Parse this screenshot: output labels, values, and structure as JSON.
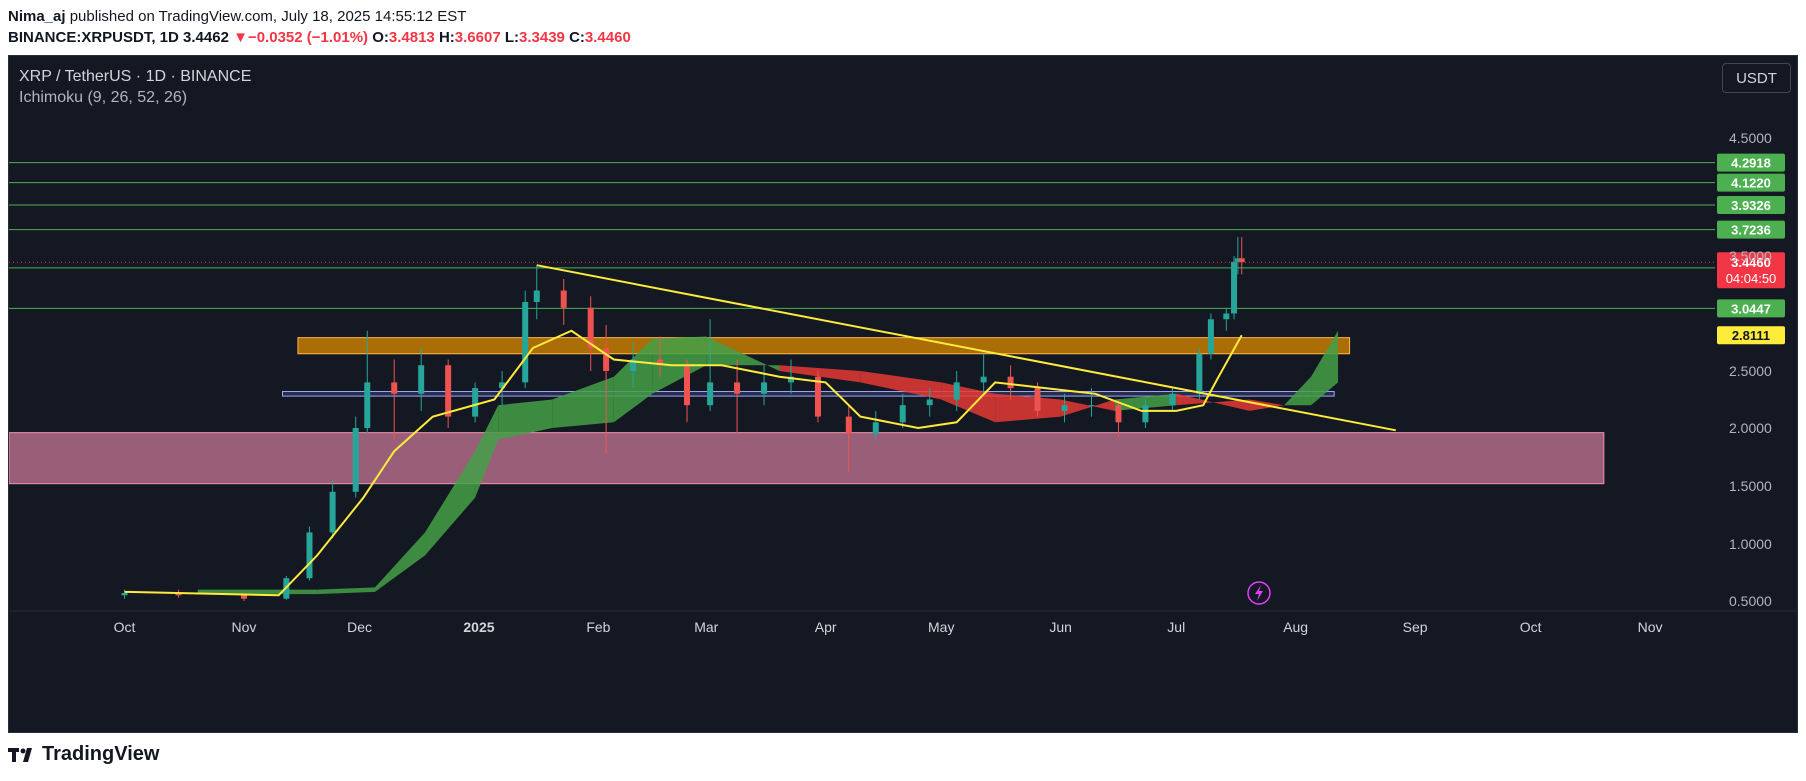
{
  "header": {
    "author": "Nima_aj",
    "published_text": "published on TradingView.com, July 18, 2025 14:55:12 EST",
    "symbol_interval": "BINANCE:XRPUSDT, 1D",
    "last": "3.4462",
    "change_arrow": "▼",
    "change": "−0.0352 (−1.01%)",
    "open_label": "O:",
    "open": "3.4813",
    "high_label": "H:",
    "high": "3.6607",
    "low_label": "L:",
    "low": "3.3439",
    "close_label": "C:",
    "close": "3.4460"
  },
  "legend": {
    "symbol_title": "XRP / TetherUS · 1D · BINANCE",
    "indicator": "Ichimoku (9, 26, 52, 26)"
  },
  "toolbar": {
    "currency": "USDT"
  },
  "footer": {
    "logo_text": "TradingView",
    "logo_icon": "tradingview-logo-icon"
  },
  "colors": {
    "background": "#141823",
    "up": "#26a69a",
    "down": "#ef5350",
    "kijun": "#ffeb3b",
    "cloud_bull": "#43a047",
    "cloud_bear": "#e53935",
    "level_line": "#4caf50",
    "resistance_zone": "#c67c00",
    "support_zone": "#f48fb1",
    "mid_band": "#9fa8ff"
  },
  "chart_data": {
    "type": "candlestick",
    "symbol": "XRPUSDT",
    "interval": "1D",
    "ylim": [
      0.3,
      5.1
    ],
    "y_ticks": [
      "4.5000",
      "3.5000",
      "2.5000",
      "2.0000",
      "1.5000",
      "1.0000",
      "0.5000"
    ],
    "x_ticks": [
      "Oct",
      "Nov",
      "Dec",
      "2025",
      "Feb",
      "Mar",
      "Apr",
      "May",
      "Jun",
      "Jul",
      "Aug",
      "Sep",
      "Oct",
      "Nov"
    ],
    "x_tick_dates": [
      "2024-10-01",
      "2024-11-01",
      "2024-12-01",
      "2025-01-01",
      "2025-02-01",
      "2025-03-01",
      "2025-04-01",
      "2025-05-01",
      "2025-06-01",
      "2025-07-01",
      "2025-08-01",
      "2025-09-01",
      "2025-10-01",
      "2025-11-01"
    ],
    "horizontal_levels": [
      {
        "label": "4.2918",
        "value": 4.2918
      },
      {
        "label": "4.1220",
        "value": 4.122
      },
      {
        "label": "3.9326",
        "value": 3.9326
      },
      {
        "label": "3.7236",
        "value": 3.7236
      },
      {
        "label": "3.3970",
        "value": 3.397
      },
      {
        "label": "3.0447",
        "value": 3.0447
      }
    ],
    "last_price": {
      "label": "3.4460",
      "value": 3.446,
      "countdown": "04:04:50"
    },
    "kijun_last": {
      "label": "2.8111",
      "value": 2.8111
    },
    "zones": [
      {
        "name": "resistance-zone",
        "low": 2.65,
        "high": 2.79,
        "from": "2024-11-15",
        "to": "2025-08-15"
      },
      {
        "name": "mid-band",
        "low": 2.28,
        "high": 2.32,
        "from": "2024-11-11",
        "to": "2025-08-11"
      },
      {
        "name": "support-zone",
        "low": 1.52,
        "high": 1.96,
        "from": "2024-09-01",
        "to": "2025-10-20"
      }
    ],
    "trendline": {
      "from": {
        "date": "2025-01-16",
        "value": 3.42
      },
      "to": {
        "date": "2025-08-27",
        "value": 1.98
      }
    },
    "ohlc": [
      [
        "2024-10-01",
        0.55,
        0.6,
        0.52,
        0.57
      ],
      [
        "2024-10-15",
        0.57,
        0.6,
        0.53,
        0.55
      ],
      [
        "2024-11-01",
        0.55,
        0.56,
        0.5,
        0.52
      ],
      [
        "2024-11-12",
        0.52,
        0.72,
        0.51,
        0.7
      ],
      [
        "2024-11-18",
        0.7,
        1.15,
        0.68,
        1.1
      ],
      [
        "2024-11-24",
        1.1,
        1.55,
        1.05,
        1.45
      ],
      [
        "2024-11-30",
        1.45,
        2.1,
        1.4,
        2.0
      ],
      [
        "2024-12-03",
        2.0,
        2.85,
        1.95,
        2.4
      ],
      [
        "2024-12-10",
        2.4,
        2.6,
        1.9,
        2.3
      ],
      [
        "2024-12-17",
        2.3,
        2.7,
        2.15,
        2.55
      ],
      [
        "2024-12-24",
        2.55,
        2.6,
        2.0,
        2.1
      ],
      [
        "2024-12-31",
        2.1,
        2.4,
        2.05,
        2.35
      ],
      [
        "2025-01-07",
        2.35,
        2.5,
        2.2,
        2.4
      ],
      [
        "2025-01-13",
        2.4,
        3.2,
        2.35,
        3.1
      ],
      [
        "2025-01-16",
        3.1,
        3.42,
        2.95,
        3.2
      ],
      [
        "2025-01-23",
        3.2,
        3.3,
        2.9,
        3.05
      ],
      [
        "2025-01-30",
        3.05,
        3.15,
        2.5,
        2.7
      ],
      [
        "2025-02-03",
        2.7,
        2.9,
        1.78,
        2.5
      ],
      [
        "2025-02-10",
        2.5,
        2.75,
        2.35,
        2.6
      ],
      [
        "2025-02-17",
        2.6,
        2.8,
        2.45,
        2.55
      ],
      [
        "2025-02-24",
        2.55,
        2.6,
        2.05,
        2.2
      ],
      [
        "2025-03-02",
        2.2,
        2.95,
        2.15,
        2.4
      ],
      [
        "2025-03-09",
        2.4,
        2.6,
        1.95,
        2.3
      ],
      [
        "2025-03-16",
        2.3,
        2.55,
        2.2,
        2.4
      ],
      [
        "2025-03-23",
        2.4,
        2.6,
        2.3,
        2.45
      ],
      [
        "2025-03-30",
        2.45,
        2.5,
        2.05,
        2.1
      ],
      [
        "2025-04-07",
        2.1,
        2.2,
        1.62,
        1.95
      ],
      [
        "2025-04-14",
        1.95,
        2.15,
        1.9,
        2.05
      ],
      [
        "2025-04-21",
        2.05,
        2.3,
        2.0,
        2.2
      ],
      [
        "2025-04-28",
        2.2,
        2.35,
        2.1,
        2.25
      ],
      [
        "2025-05-05",
        2.25,
        2.5,
        2.15,
        2.4
      ],
      [
        "2025-05-12",
        2.4,
        2.65,
        2.3,
        2.45
      ],
      [
        "2025-05-19",
        2.45,
        2.55,
        2.25,
        2.35
      ],
      [
        "2025-05-26",
        2.35,
        2.4,
        2.1,
        2.15
      ],
      [
        "2025-06-02",
        2.15,
        2.3,
        2.05,
        2.2
      ],
      [
        "2025-06-09",
        2.2,
        2.35,
        2.1,
        2.2
      ],
      [
        "2025-06-16",
        2.2,
        2.25,
        1.92,
        2.05
      ],
      [
        "2025-06-23",
        2.05,
        2.25,
        2.0,
        2.2
      ],
      [
        "2025-06-30",
        2.2,
        2.35,
        2.15,
        2.3
      ],
      [
        "2025-07-07",
        2.3,
        2.7,
        2.25,
        2.65
      ],
      [
        "2025-07-10",
        2.65,
        3.0,
        2.6,
        2.95
      ],
      [
        "2025-07-14",
        2.95,
        3.05,
        2.85,
        3.0
      ],
      [
        "2025-07-16",
        3.0,
        3.5,
        2.95,
        3.45
      ],
      [
        "2025-07-17",
        3.45,
        3.66,
        3.34,
        3.48
      ],
      [
        "2025-07-18",
        3.48,
        3.66,
        3.34,
        3.446
      ]
    ],
    "kijun_sen": [
      [
        "2024-10-01",
        0.58
      ],
      [
        "2024-11-10",
        0.55
      ],
      [
        "2024-11-20",
        0.9
      ],
      [
        "2024-12-02",
        1.4
      ],
      [
        "2024-12-10",
        1.8
      ],
      [
        "2024-12-20",
        2.1
      ],
      [
        "2025-01-05",
        2.25
      ],
      [
        "2025-01-15",
        2.7
      ],
      [
        "2025-01-25",
        2.85
      ],
      [
        "2025-02-05",
        2.6
      ],
      [
        "2025-02-20",
        2.55
      ],
      [
        "2025-03-05",
        2.55
      ],
      [
        "2025-03-20",
        2.45
      ],
      [
        "2025-04-01",
        2.4
      ],
      [
        "2025-04-10",
        2.1
      ],
      [
        "2025-04-25",
        2.0
      ],
      [
        "2025-05-05",
        2.05
      ],
      [
        "2025-05-15",
        2.4
      ],
      [
        "2025-05-28",
        2.35
      ],
      [
        "2025-06-10",
        2.3
      ],
      [
        "2025-06-22",
        2.15
      ],
      [
        "2025-07-01",
        2.15
      ],
      [
        "2025-07-08",
        2.2
      ],
      [
        "2025-07-12",
        2.45
      ],
      [
        "2025-07-18",
        2.8111
      ]
    ],
    "cloud": [
      [
        "2024-10-20",
        0.56,
        0.6
      ],
      [
        "2024-11-20",
        0.56,
        0.6
      ],
      [
        "2024-12-05",
        0.58,
        0.62
      ],
      [
        "2024-12-18",
        0.9,
        1.1
      ],
      [
        "2024-12-31",
        1.4,
        1.8
      ],
      [
        "2025-01-06",
        1.9,
        2.2
      ],
      [
        "2025-01-20",
        2.0,
        2.25
      ],
      [
        "2025-02-05",
        2.05,
        2.45
      ],
      [
        "2025-02-15",
        2.3,
        2.78
      ],
      [
        "2025-03-01",
        2.55,
        2.8
      ],
      [
        "2025-03-20",
        2.55,
        2.5
      ],
      [
        "2025-04-10",
        2.5,
        2.4
      ],
      [
        "2025-05-01",
        2.4,
        2.25
      ],
      [
        "2025-05-15",
        2.3,
        2.05
      ],
      [
        "2025-06-01",
        2.25,
        2.1
      ],
      [
        "2025-06-15",
        2.15,
        2.25
      ],
      [
        "2025-07-01",
        2.2,
        2.3
      ],
      [
        "2025-07-20",
        2.25,
        2.15
      ],
      [
        "2025-07-29",
        2.2,
        2.2
      ],
      [
        "2025-08-05",
        2.2,
        2.45
      ],
      [
        "2025-08-12",
        2.4,
        2.85
      ]
    ]
  }
}
